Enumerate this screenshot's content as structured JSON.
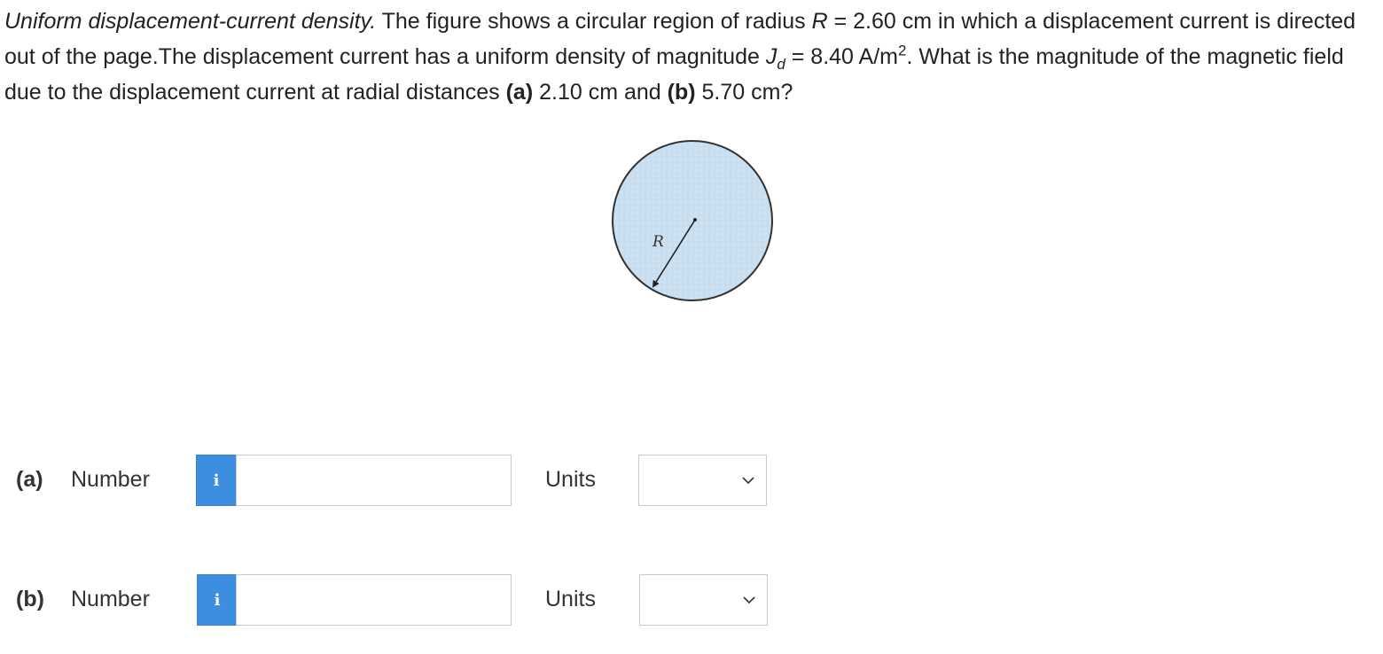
{
  "problem": {
    "lead": "Uniform displacement-current density.",
    "t1": " The figure shows a circular region of radius ",
    "var_R": "R",
    "t2": " = 2.60 cm in which a displacement current is directed out of the page.The displacement current has a uniform density of magnitude ",
    "var_J": "J",
    "sub_d": "d",
    "t3": " = 8.40 A/m",
    "sup_2": "2",
    "t4": ". What is the magnitude of the magnetic field due to the displacement current at radial distances ",
    "part_a": "(a)",
    "t5": " 2.10 cm and ",
    "part_b": "(b)",
    "t6": " 5.70 cm?"
  },
  "figure": {
    "label": "R",
    "fill_color": "#c9dff0",
    "stroke_color": "#333333"
  },
  "answers": [
    {
      "part": "(a)",
      "number_label": "Number",
      "info_icon": "i",
      "number_value": "",
      "units_label": "Units",
      "units_value": ""
    },
    {
      "part": "(b)",
      "number_label": "Number",
      "info_icon": "i",
      "number_value": "",
      "units_label": "Units",
      "units_value": ""
    }
  ],
  "colors": {
    "info_button": "#3d8ee0",
    "text": "#222222",
    "border": "#c9c9c9"
  }
}
